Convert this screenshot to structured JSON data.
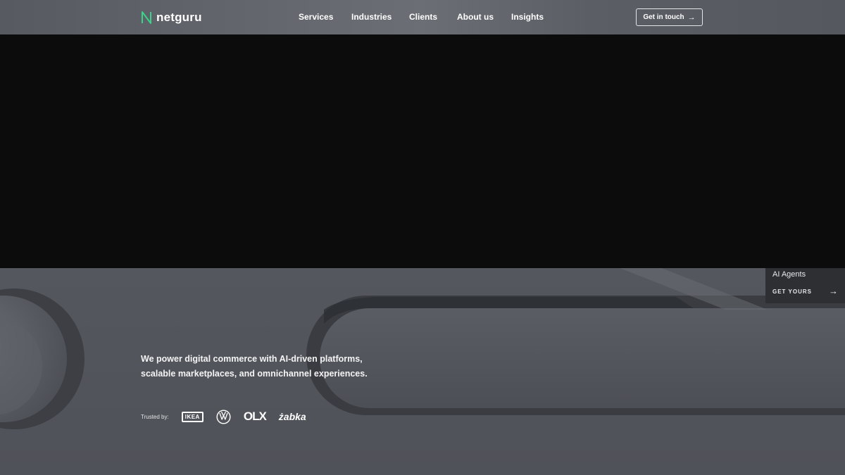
{
  "header": {
    "logo_text": "netguru",
    "nav": [
      "Services",
      "Industries",
      "Clients",
      "About us",
      "Insights"
    ],
    "cta_label": "Get in touch"
  },
  "widget": {
    "title": "AI Agents",
    "link": "GET YOURS"
  },
  "hero": {
    "line1": "We power digital commerce with AI-driven platforms,",
    "line2": "scalable marketplaces, and omnichannel experiences."
  },
  "trusted": {
    "label": "Trusted by:",
    "brands": {
      "ikea": "IKEA",
      "olx": "OLX",
      "zabka": "żabka"
    }
  },
  "colors": {
    "accent": "#3ad38a",
    "video_bg": "#0c0c0d",
    "widget_bg": "#2d2f33"
  }
}
